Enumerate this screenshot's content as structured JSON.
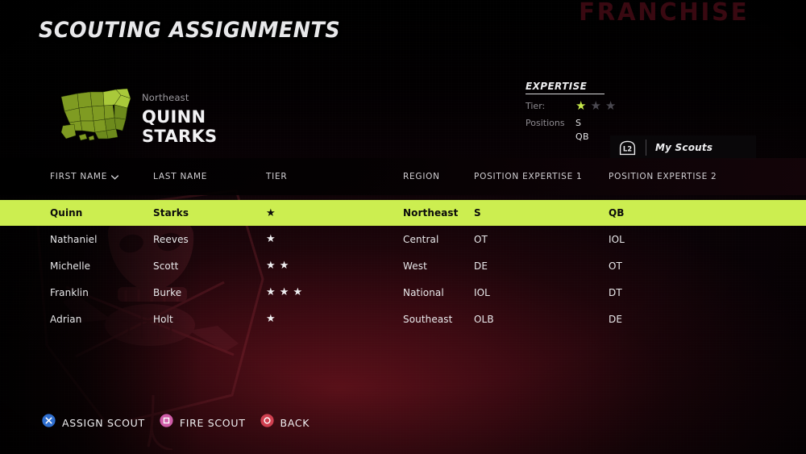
{
  "screen": {
    "title": "SCOUTING ASSIGNMENTS",
    "franchise_watermark": "FRANCHISE",
    "accent_color": "#ccee50",
    "background_color": "#3d0a12"
  },
  "hero": {
    "region": "Northeast",
    "first_name": "QUINN",
    "last_name": "STARKS",
    "map_icon": "us-map-icon"
  },
  "expertise": {
    "title": "EXPERTISE",
    "tier_label": "Tier:",
    "tier_filled": 1,
    "tier_total": 3,
    "positions_label": "Positions",
    "positions": [
      "S",
      "QB"
    ]
  },
  "my_scouts_button": {
    "button_glyph": "L2",
    "label": "My Scouts"
  },
  "table": {
    "columns": [
      {
        "key": "first_name",
        "label": "FIRST NAME",
        "sorted": true,
        "sort_icon": "chevron-down-icon"
      },
      {
        "key": "last_name",
        "label": "LAST NAME",
        "sorted": false
      },
      {
        "key": "tier",
        "label": "TIER",
        "sorted": false
      },
      {
        "key": "region",
        "label": "REGION",
        "sorted": false
      },
      {
        "key": "pe1",
        "label": "POSITION EXPERTISE 1",
        "sorted": false
      },
      {
        "key": "pe2",
        "label": "POSITION EXPERTISE 2",
        "sorted": false
      }
    ],
    "rows": [
      {
        "first_name": "Quinn",
        "last_name": "Starks",
        "tier": 1,
        "region": "Northeast",
        "pe1": "S",
        "pe2": "QB",
        "selected": true
      },
      {
        "first_name": "Nathaniel",
        "last_name": "Reeves",
        "tier": 1,
        "region": "Central",
        "pe1": "OT",
        "pe2": "IOL",
        "selected": false
      },
      {
        "first_name": "Michelle",
        "last_name": "Scott",
        "tier": 2,
        "region": "West",
        "pe1": "DE",
        "pe2": "OT",
        "selected": false
      },
      {
        "first_name": "Franklin",
        "last_name": "Burke",
        "tier": 3,
        "region": "National",
        "pe1": "IOL",
        "pe2": "DT",
        "selected": false
      },
      {
        "first_name": "Adrian",
        "last_name": "Holt",
        "tier": 1,
        "region": "Southeast",
        "pe1": "OLB",
        "pe2": "DE",
        "selected": false
      }
    ]
  },
  "footer": {
    "actions": [
      {
        "icon": "playstation-cross-icon",
        "label": "ASSIGN SCOUT",
        "color": "#2f6fd0"
      },
      {
        "icon": "playstation-square-icon",
        "label": "FIRE SCOUT",
        "color": "#d05ca8"
      },
      {
        "icon": "playstation-circle-icon",
        "label": "BACK",
        "color": "#d04050"
      }
    ]
  }
}
